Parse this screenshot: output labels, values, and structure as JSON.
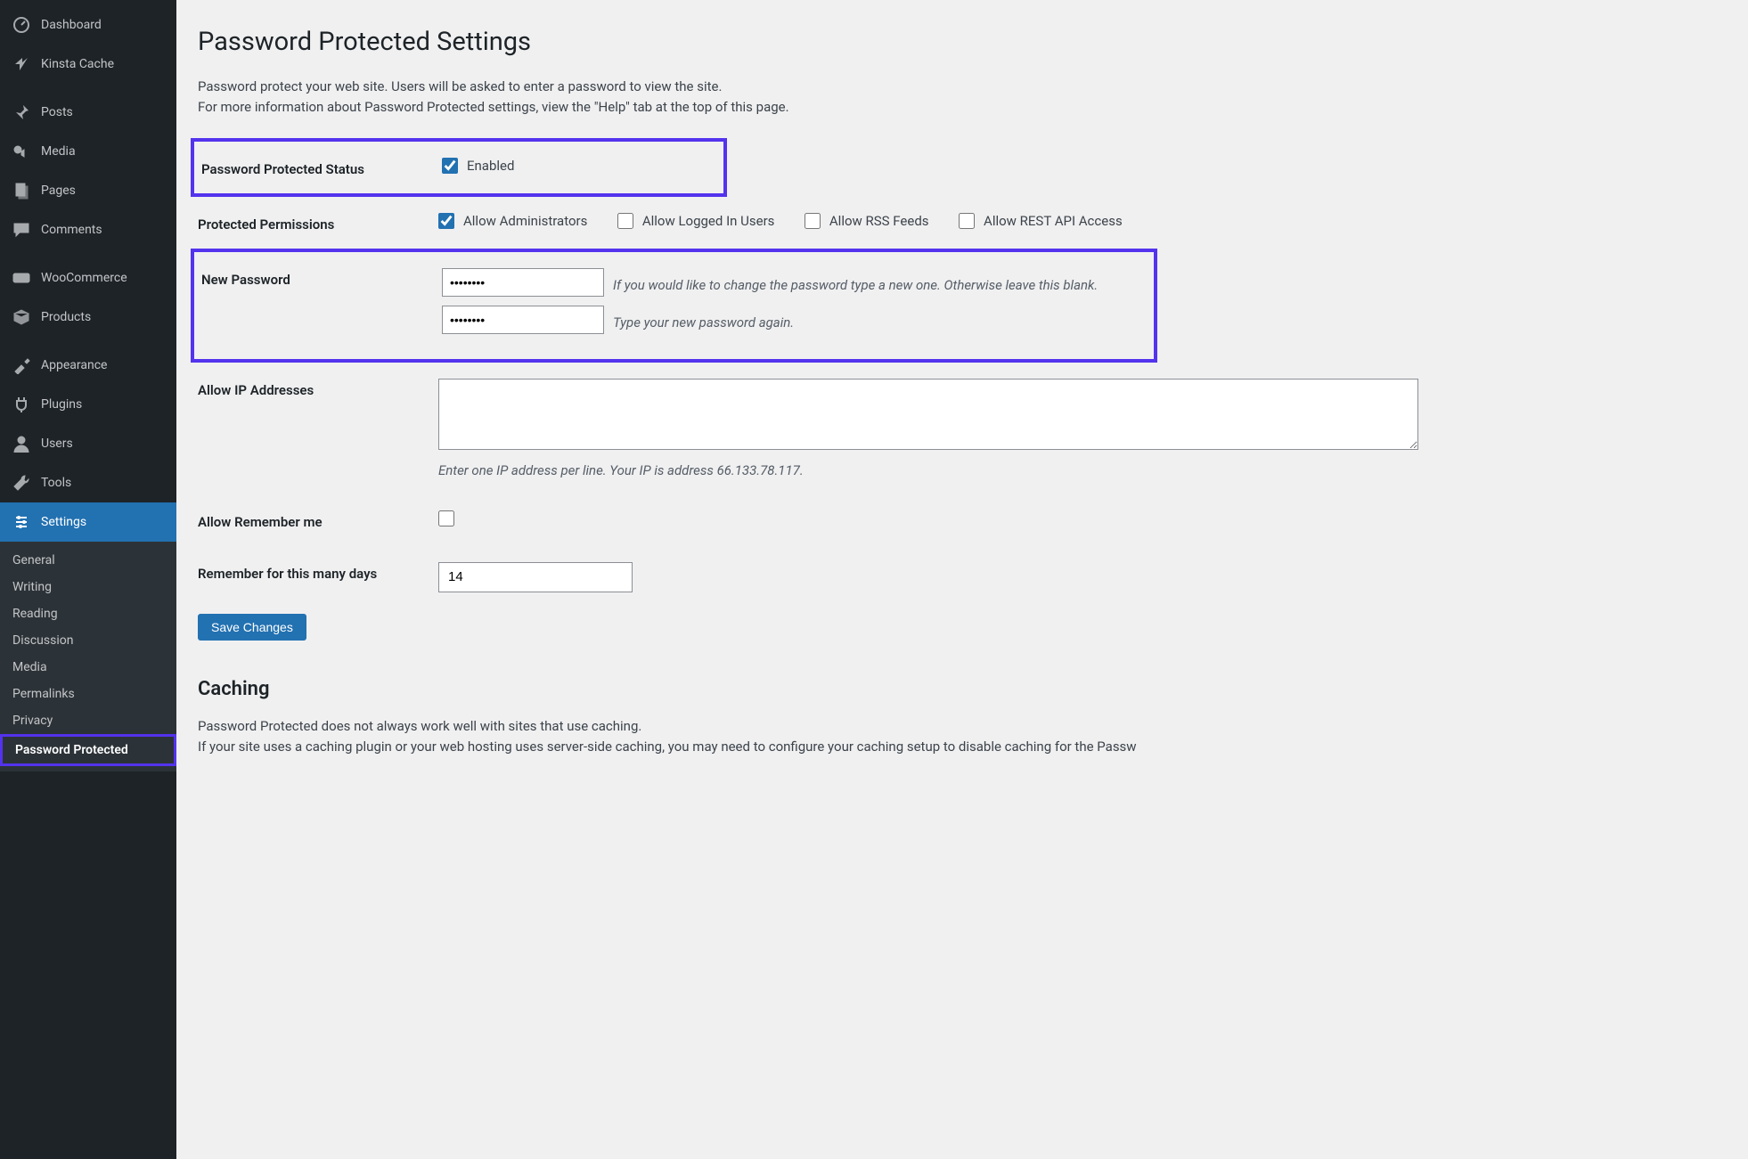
{
  "sidebar": {
    "items": [
      {
        "icon": "dashboard-icon",
        "label": "Dashboard"
      },
      {
        "icon": "kinsta-icon",
        "label": "Kinsta Cache"
      },
      {
        "icon": "pin-icon",
        "label": "Posts"
      },
      {
        "icon": "media-icon",
        "label": "Media"
      },
      {
        "icon": "pages-icon",
        "label": "Pages"
      },
      {
        "icon": "comments-icon",
        "label": "Comments"
      },
      {
        "icon": "woo-icon",
        "label": "WooCommerce"
      },
      {
        "icon": "products-icon",
        "label": "Products"
      },
      {
        "icon": "appearance-icon",
        "label": "Appearance"
      },
      {
        "icon": "plugins-icon",
        "label": "Plugins"
      },
      {
        "icon": "users-icon",
        "label": "Users"
      },
      {
        "icon": "tools-icon",
        "label": "Tools"
      },
      {
        "icon": "settings-icon",
        "label": "Settings",
        "active": true
      }
    ],
    "submenu": [
      "General",
      "Writing",
      "Reading",
      "Discussion",
      "Media",
      "Permalinks",
      "Privacy",
      "Password Protected"
    ]
  },
  "page": {
    "title": "Password Protected Settings",
    "intro1": "Password protect your web site. Users will be asked to enter a password to view the site.",
    "intro2": "For more information about Password Protected settings, view the \"Help\" tab at the top of this page."
  },
  "form": {
    "status_label": "Password Protected Status",
    "status_enabled": "Enabled",
    "permissions_label": "Protected Permissions",
    "perm_admins": "Allow Administrators",
    "perm_logged": "Allow Logged In Users",
    "perm_rss": "Allow RSS Feeds",
    "perm_rest": "Allow REST API Access",
    "newpw_label": "New Password",
    "newpw_hint1": "If you would like to change the password type a new one. Otherwise leave this blank.",
    "newpw_hint2": "Type your new password again.",
    "pw_value": "••••••••",
    "ip_label": "Allow IP Addresses",
    "ip_desc": "Enter one IP address per line. Your IP is address 66.133.78.117.",
    "remember_label": "Allow Remember me",
    "days_label": "Remember for this many days",
    "days_value": "14",
    "save_label": "Save Changes"
  },
  "caching": {
    "title": "Caching",
    "line1": "Password Protected does not always work well with sites that use caching.",
    "line2": "If your site uses a caching plugin or your web hosting uses server-side caching, you may need to configure your caching setup to disable caching for the Passw"
  }
}
